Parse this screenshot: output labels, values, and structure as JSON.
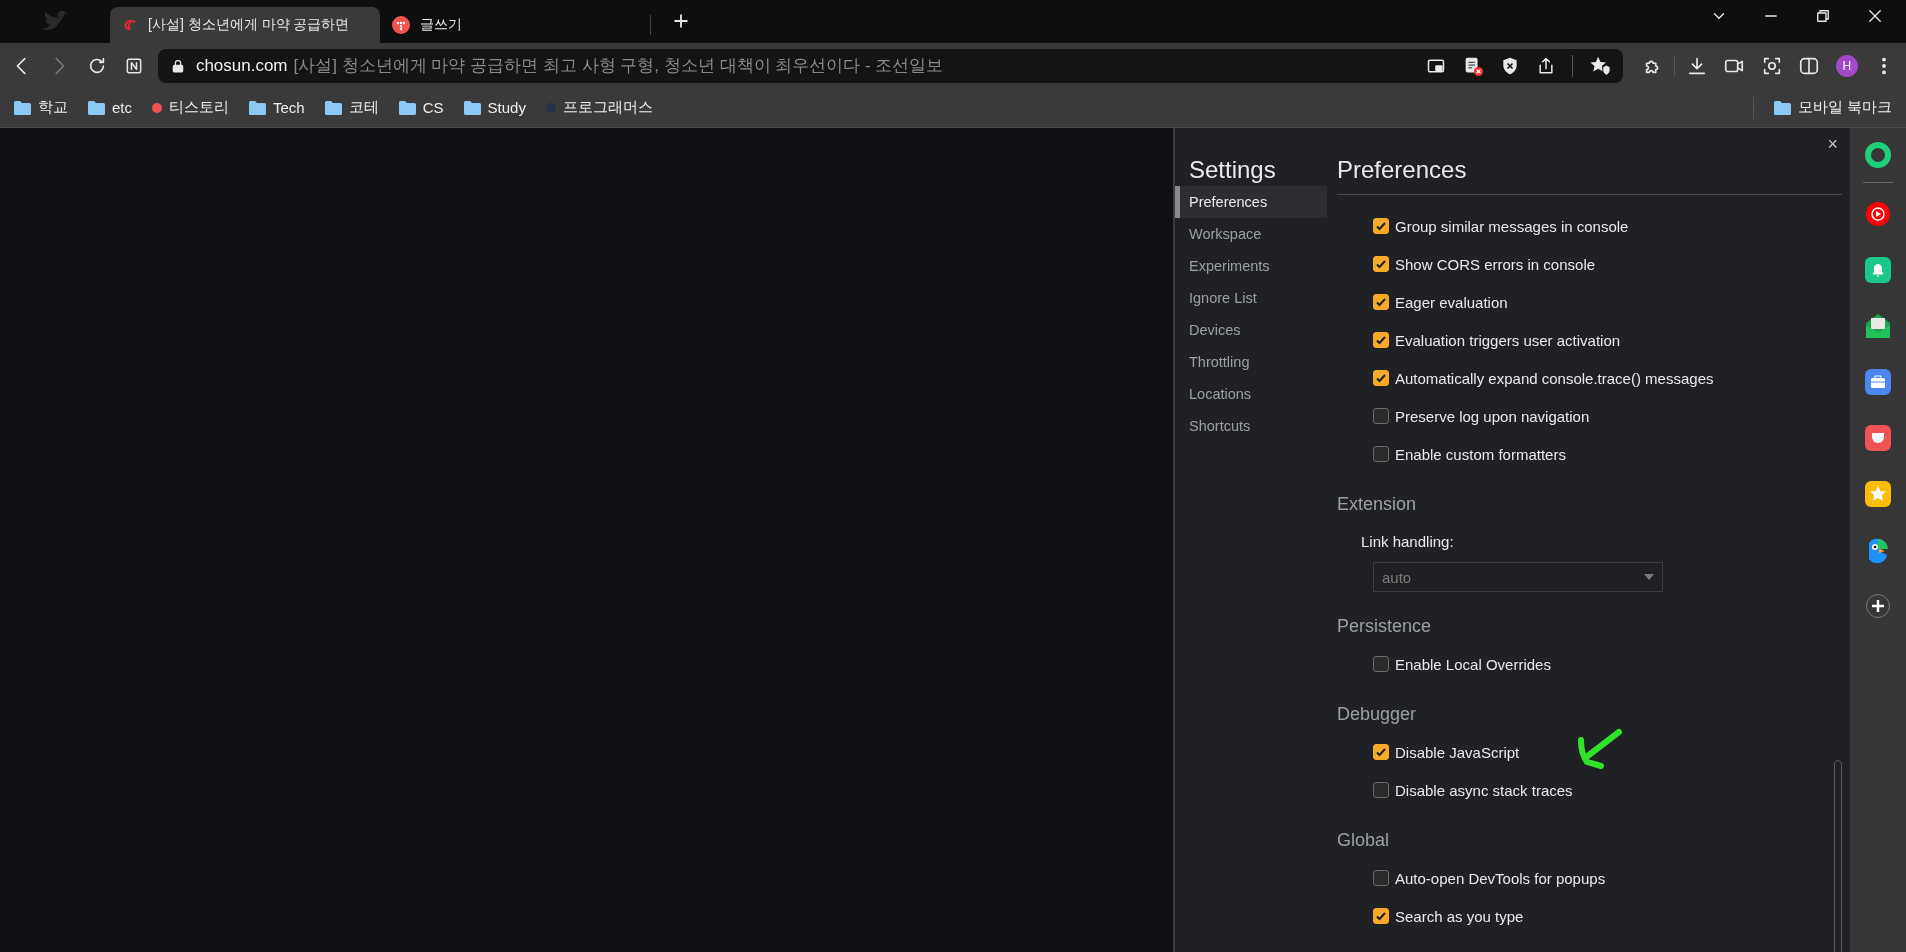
{
  "tabs": [
    {
      "kind": "news",
      "title": "[사설] 청소년에게 마약 공급하면",
      "selected": true
    },
    {
      "kind": "blog",
      "title": "글쓰기",
      "selected": false
    }
  ],
  "address": {
    "domain": "chosun.com",
    "page_title": "[사설] 청소년에게 마약 공급하면 최고 사형 구형, 청소년 대책이 최우선이다 - 조선일보"
  },
  "profile": {
    "initial": "H"
  },
  "bookmarks": [
    {
      "kind": "folder",
      "label": "학교"
    },
    {
      "kind": "folder",
      "label": "etc"
    },
    {
      "kind": "dot",
      "label": "티스토리",
      "color": "#f0544f"
    },
    {
      "kind": "folder",
      "label": "Tech"
    },
    {
      "kind": "folder",
      "label": "코테"
    },
    {
      "kind": "folder",
      "label": "CS"
    },
    {
      "kind": "folder",
      "label": "Study"
    },
    {
      "kind": "dot",
      "label": "프로그래머스",
      "color": "#263046"
    }
  ],
  "mobile_bookmarks": {
    "label": "모바일 북마크"
  },
  "settings": {
    "title": "Settings",
    "close": "×",
    "nav": [
      {
        "label": "Preferences",
        "selected": true
      },
      {
        "label": "Workspace",
        "selected": false
      },
      {
        "label": "Experiments",
        "selected": false
      },
      {
        "label": "Ignore List",
        "selected": false
      },
      {
        "label": "Devices",
        "selected": false
      },
      {
        "label": "Throttling",
        "selected": false
      },
      {
        "label": "Locations",
        "selected": false
      },
      {
        "label": "Shortcuts",
        "selected": false
      }
    ],
    "panel_title": "Preferences",
    "sections": [
      {
        "items": [
          {
            "kind": "checkbox",
            "label": "Group similar messages in console",
            "checked": true
          },
          {
            "kind": "checkbox",
            "label": "Show CORS errors in console",
            "checked": true
          },
          {
            "kind": "checkbox",
            "label": "Eager evaluation",
            "checked": true
          },
          {
            "kind": "checkbox",
            "label": "Evaluation triggers user activation",
            "checked": true
          },
          {
            "kind": "checkbox",
            "label": "Automatically expand console.trace() messages",
            "checked": true
          },
          {
            "kind": "checkbox",
            "label": "Preserve log upon navigation",
            "checked": false
          },
          {
            "kind": "checkbox",
            "label": "Enable custom formatters",
            "checked": false
          }
        ]
      },
      {
        "heading": "Extension",
        "items": [
          {
            "kind": "select",
            "label": "Link handling:",
            "value": "auto",
            "disabled": true
          }
        ]
      },
      {
        "heading": "Persistence",
        "items": [
          {
            "kind": "checkbox",
            "label": "Enable Local Overrides",
            "checked": false
          }
        ]
      },
      {
        "heading": "Debugger",
        "items": [
          {
            "kind": "checkbox",
            "label": "Disable JavaScript",
            "checked": true,
            "annotated": true
          },
          {
            "kind": "checkbox",
            "label": "Disable async stack traces",
            "checked": false
          }
        ]
      },
      {
        "heading": "Global",
        "items": [
          {
            "kind": "checkbox",
            "label": "Auto-open DevTools for popups",
            "checked": false
          },
          {
            "kind": "checkbox",
            "label": "Search as you type",
            "checked": true
          }
        ]
      }
    ]
  }
}
